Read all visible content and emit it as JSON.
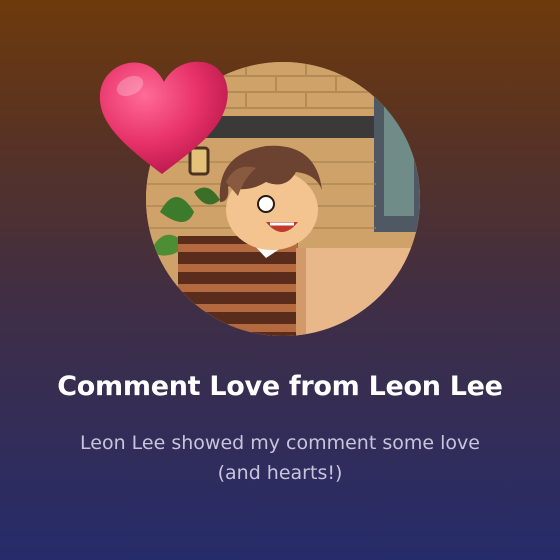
{
  "notification": {
    "title": "Comment Love from Leon Lee",
    "message": "Leon Lee showed my comment some love (and hearts!)"
  },
  "colors": {
    "background_top": "#6e3a0c",
    "background_bottom": "#262c6a",
    "heart": "#e8336a",
    "title": "#ffffff",
    "message": "#c8c4dc"
  },
  "icons": {
    "badge": "heart-icon",
    "avatar": "user-avatar"
  }
}
